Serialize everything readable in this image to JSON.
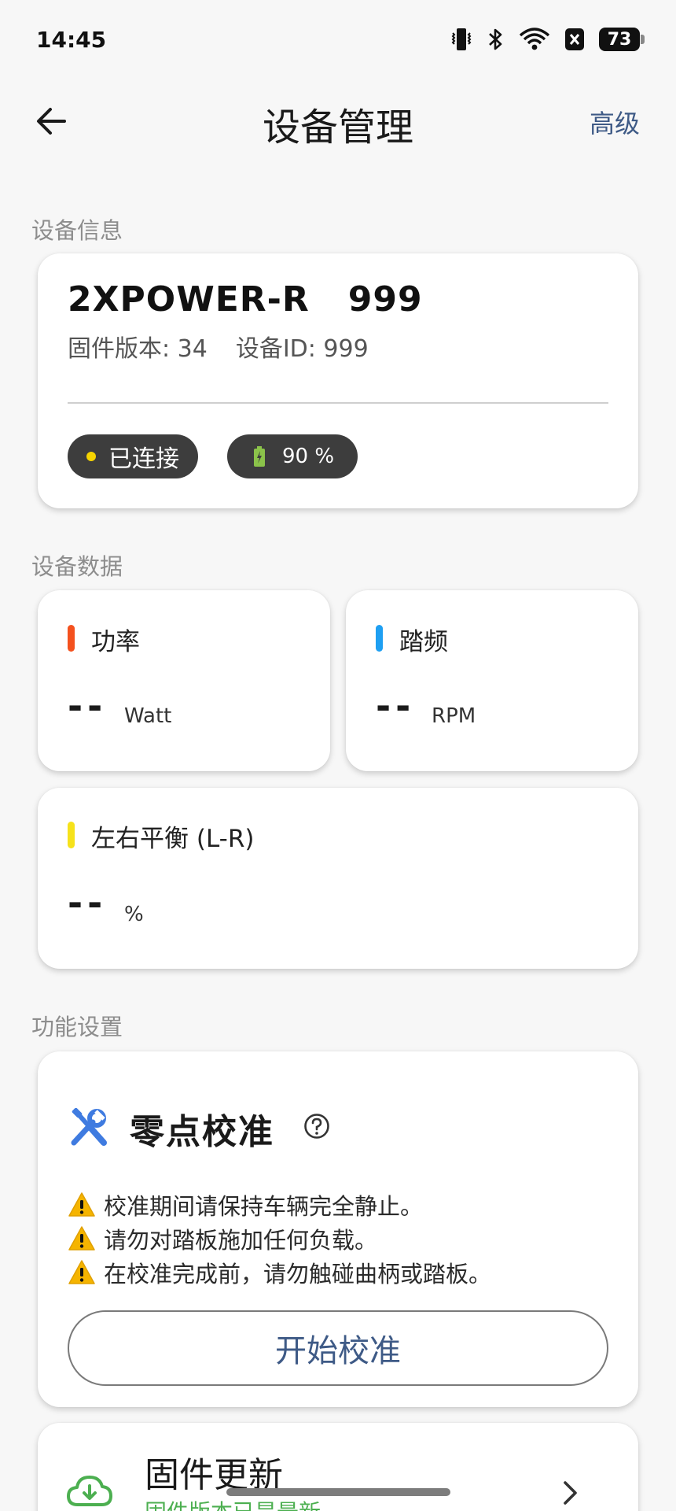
{
  "status_bar": {
    "time": "14:45",
    "battery": "73"
  },
  "app_bar": {
    "title": "设备管理",
    "advanced": "高级"
  },
  "sections": {
    "info": "设备信息",
    "data": "设备数据",
    "functions": "功能设置"
  },
  "device": {
    "name": "2XPOWER-R   999",
    "firmware": "固件版本: 34",
    "device_id": "设备ID: 999",
    "connection": "已连接",
    "battery": "90 %"
  },
  "metrics": [
    {
      "label": "功率",
      "value": "--",
      "unit": "Watt",
      "color": "#f4511e"
    },
    {
      "label": "踏频",
      "value": "--",
      "unit": "RPM",
      "color": "#1e9ff2"
    },
    {
      "label": "左右平衡 (L-R)",
      "value": "--",
      "unit": "%",
      "color": "#f6e21b"
    }
  ],
  "calibration": {
    "title": "零点校准",
    "warnings": [
      "校准期间请保持车辆完全静止。",
      "请勿对踏板施加任何负载。",
      "在校准完成前，请勿触碰曲柄或踏板。"
    ],
    "button": "开始校准"
  },
  "firmware": {
    "title": "固件更新",
    "subtitle": "固件版本已是最新"
  },
  "colors": {
    "accent": "#3e5a86",
    "chip": "#3d3d3d",
    "success": "#4caf50"
  }
}
